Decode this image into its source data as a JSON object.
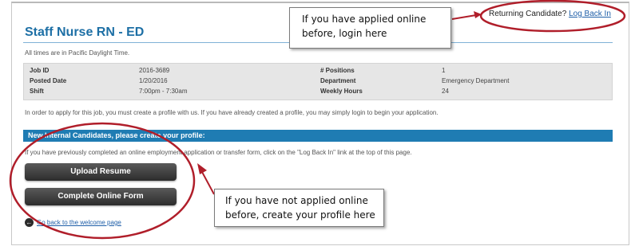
{
  "header": {
    "returning_label": "Returning Candidate?",
    "log_back_in": "Log Back In"
  },
  "job": {
    "title": "Staff Nurse RN - ED",
    "timezone_note": "All times are in Pacific Daylight Time.",
    "details": {
      "job_id_label": "Job ID",
      "job_id": "2016-3689",
      "posted_label": "Posted Date",
      "posted": "1/20/2016",
      "shift_label": "Shift",
      "shift": "7:00pm - 7:30am",
      "positions_label": "# Positions",
      "positions": "1",
      "department_label": "Department",
      "department": "Emergency Department",
      "hours_label": "Weekly Hours",
      "hours": "24"
    },
    "intro_text": "In order to apply for this job, you must create a profile with us. If you have already created a profile, you may simply login to begin your application."
  },
  "candidates": {
    "section_title": "New Internal Candidates, please create your profile:",
    "previous_note": "If you have previously completed an online employment application or transfer form, click on the \"Log Back In\" link at the top of this page.",
    "upload_button": "Upload Resume",
    "complete_button": "Complete Online Form",
    "back_link": "Go back to the welcome page"
  },
  "annotations": {
    "top_line1": "If you have applied online",
    "top_line2": "before, login here",
    "bottom_line1": "If you have not applied online",
    "bottom_line2": "before, create your profile here"
  },
  "colors": {
    "accent_blue": "#1f7cb3",
    "title_blue": "#1d6fa5",
    "annotation_red": "#b01e2a"
  },
  "icons": {
    "back": "circle-arrow-left-icon"
  }
}
